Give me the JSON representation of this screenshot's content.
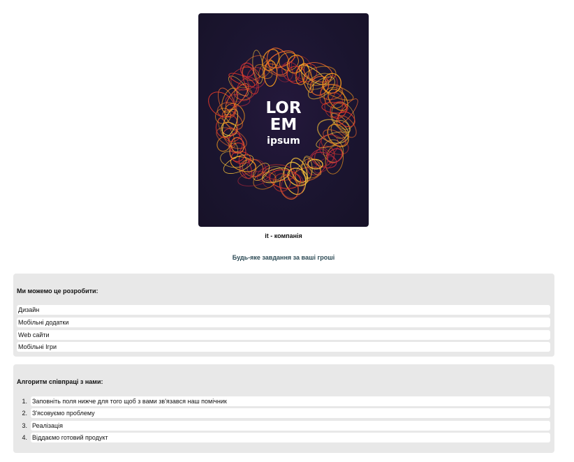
{
  "logo": {
    "line1": "LOR",
    "line2": "EM",
    "line3": "ipsum",
    "icon": "abstract-orange-swirl-ring"
  },
  "company": {
    "name": "it - компанія",
    "tagline": "Будь-яке завдання за ваші гроші"
  },
  "services": {
    "title": "Ми можемо це розробити:",
    "items": [
      "Дизайн",
      "Мобільні додатки",
      "Web сайти",
      "Мобільні Ігри"
    ]
  },
  "process": {
    "title": "Алгоритм співпраці з нами:",
    "steps": [
      {
        "num": "1.",
        "text": "Заповніть поля нижче для того щоб з вами зв'язався наш помічник"
      },
      {
        "num": "2.",
        "text": "З'ясовуємо проблему"
      },
      {
        "num": "3.",
        "text": "Реалізація"
      },
      {
        "num": "4.",
        "text": "Віддаємо готовий продукт"
      }
    ]
  },
  "colors": {
    "logo_background": "#1b1530",
    "swirl_orange": "#f59a1c",
    "swirl_red": "#d9362a",
    "tagline": "#2c4a55",
    "panel_background": "#e8e8e8"
  }
}
